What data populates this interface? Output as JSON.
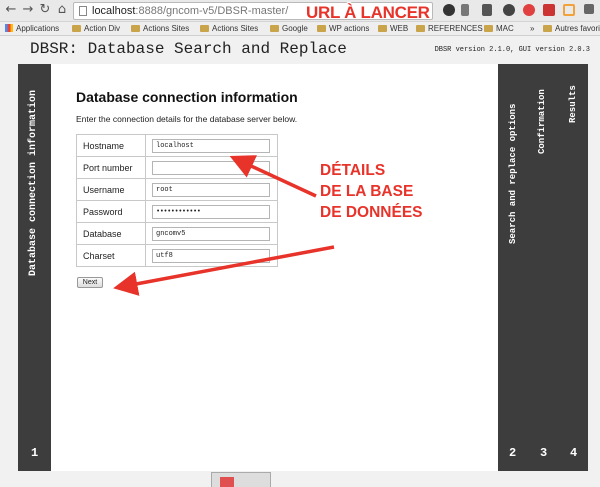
{
  "browser": {
    "url_host": "localhost",
    "url_path": ":8888/gncom-v5/DBSR-master/",
    "bookmarks": [
      "Applications",
      "Action Div",
      "Actions Sites",
      "Actions Sites",
      "Google",
      "WP actions",
      "WEB",
      "REFERENCES",
      "MAC",
      "»",
      "Autres favoris"
    ]
  },
  "annotations": {
    "url": "URL À LANCER",
    "details": [
      "DÉTAILS",
      "DE LA BASE",
      "DE DONNÉES"
    ],
    "color": "#e8332a"
  },
  "header": {
    "title": "DBSR: Database Search and Replace",
    "version": "DBSR version 2.1.0, GUI version 2.0.3"
  },
  "steps": [
    {
      "label": "Database connection information",
      "number": "1"
    },
    {
      "label": "Search and replace options",
      "number": "2"
    },
    {
      "label": "Confirmation",
      "number": "3"
    },
    {
      "label": "Results",
      "number": "4"
    }
  ],
  "form": {
    "heading": "Database connection information",
    "intro": "Enter the connection details for the database server below.",
    "rows": [
      {
        "label": "Hostname",
        "value": "localhost"
      },
      {
        "label": "Port number",
        "value": ""
      },
      {
        "label": "Username",
        "value": "root"
      },
      {
        "label": "Password",
        "value": "••••••••••••"
      },
      {
        "label": "Database",
        "value": "gncomv5"
      },
      {
        "label": "Charset",
        "value": "utf8"
      }
    ],
    "next_label": "Next"
  }
}
